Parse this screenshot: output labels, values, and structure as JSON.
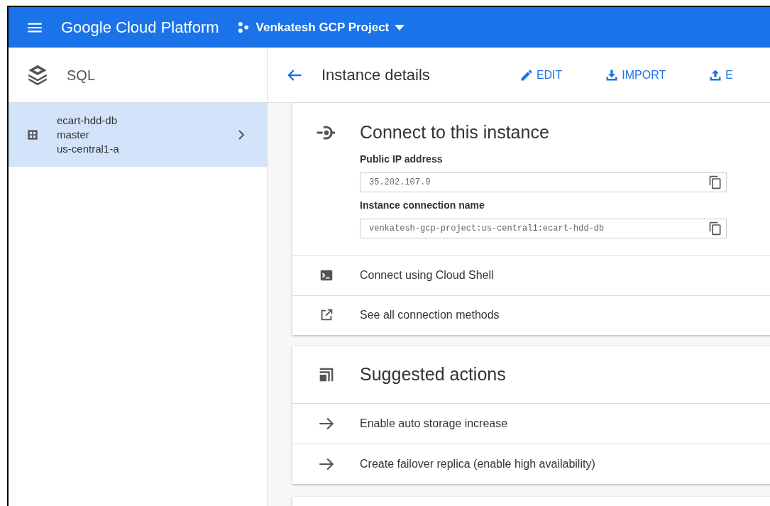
{
  "topbar": {
    "title": "Google Cloud Platform",
    "project": "Venkatesh GCP Project"
  },
  "sidebar": {
    "title": "SQL",
    "items": [
      {
        "lines": [
          "ecart-hdd-db",
          "master",
          "us-central1-a"
        ],
        "selected": true
      }
    ]
  },
  "header": {
    "title": "Instance details",
    "actions": [
      {
        "label": "EDIT",
        "kind": "edit"
      },
      {
        "label": "IMPORT",
        "kind": "import"
      },
      {
        "label": "E",
        "kind": "export"
      }
    ]
  },
  "connect_card": {
    "title": "Connect to this instance",
    "fields": [
      {
        "label": "Public IP address",
        "value": "35.202.107.9"
      },
      {
        "label": "Instance connection name",
        "value": "venkatesh-gcp-project:us-central1:ecart-hdd-db"
      }
    ],
    "links": [
      {
        "label": "Connect using Cloud Shell",
        "kind": "shell"
      },
      {
        "label": "See all connection methods",
        "kind": "external"
      }
    ]
  },
  "suggested_card": {
    "title": "Suggested actions",
    "actions": [
      {
        "label": "Enable auto storage increase"
      },
      {
        "label": "Create failover replica (enable high availability)"
      }
    ]
  }
}
